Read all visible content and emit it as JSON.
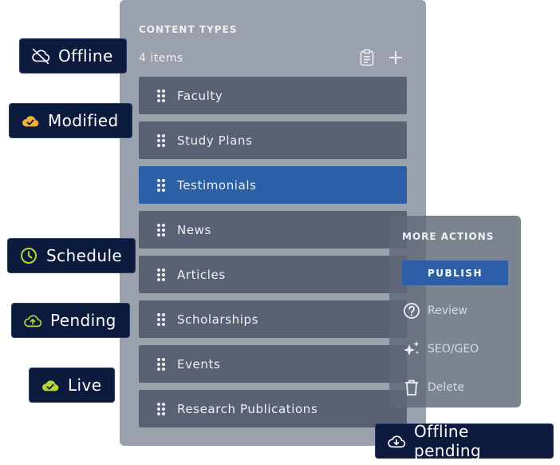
{
  "content_types": {
    "title": "CONTENT TYPES",
    "count": "4 items",
    "items": [
      {
        "label": "Faculty"
      },
      {
        "label": "Study Plans"
      },
      {
        "label": "Testimonials"
      },
      {
        "label": "News"
      },
      {
        "label": "Articles"
      },
      {
        "label": "Scholarships"
      },
      {
        "label": "Events"
      },
      {
        "label": "Research Publications"
      }
    ],
    "active_item": "Testimonials"
  },
  "more_actions": {
    "title": "MORE ACTIONS",
    "publish": "PUBLISH",
    "review": "Review",
    "seo": "SEO/GEO",
    "delete": "Delete"
  },
  "status_badges": {
    "offline": "Offline",
    "modified": "Modified",
    "schedule": "Schedule",
    "pending": "Pending",
    "live": "Live",
    "offline_pending": "Offline pending"
  },
  "colors": {
    "accent": "#2b5fa6",
    "badge_bg": "#0b1a3d",
    "modified_icon": "#f2b233",
    "live_icon": "#b8d432"
  },
  "icons": {
    "clipboard": "clipboard-icon",
    "add": "plus-icon",
    "drag": "drag-handle-icon",
    "review": "question-circle-icon",
    "seo": "sparkles-icon",
    "delete": "trash-icon"
  }
}
